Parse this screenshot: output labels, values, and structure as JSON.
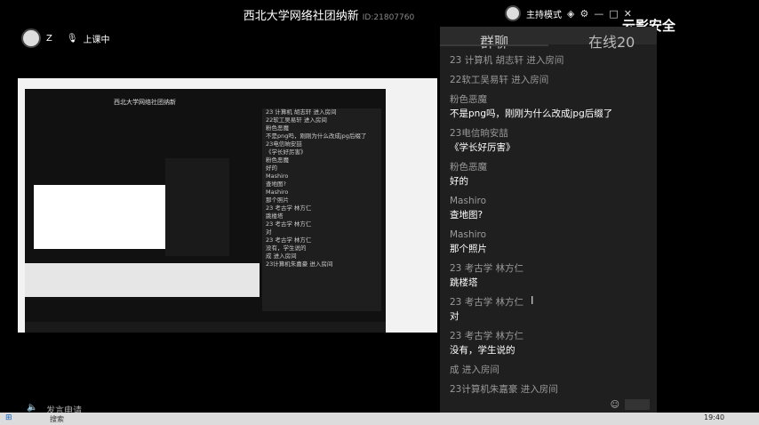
{
  "window": {
    "title": "西北大学网络社团纳新",
    "room_id": "ID:21807760",
    "host_mode": "主持模式"
  },
  "user": {
    "name": "Z",
    "status": "上课中"
  },
  "watermark": "云影安全",
  "chat": {
    "tab_chat": "群聊",
    "tab_online": "在线20",
    "messages": [
      {
        "type": "system",
        "text": "23 计算机 胡志轩 进入房间"
      },
      {
        "type": "system",
        "text": "22软工吴易轩 进入房间"
      },
      {
        "type": "message",
        "name": "粉色恶魔",
        "text": "不是png吗，刚刚为什么改成jpg后缀了"
      },
      {
        "type": "message",
        "name": "23电信晌安喆",
        "text": "《学长好厉害》"
      },
      {
        "type": "message",
        "name": "粉色恶魔",
        "text": "好的"
      },
      {
        "type": "message",
        "name": "Mashiro",
        "text": "查地图?"
      },
      {
        "type": "message",
        "name": "Mashiro",
        "text": "那个照片"
      },
      {
        "type": "message",
        "name": "23 考古学 林方仁",
        "text": "跳楼塔"
      },
      {
        "type": "message",
        "name": "23 考古学 林方仁",
        "text": "对"
      },
      {
        "type": "message",
        "name": "23 考古学 林方仁",
        "text": "没有，学生说的"
      },
      {
        "type": "system",
        "text": "成 进入房间"
      },
      {
        "type": "system",
        "text": "23计算机朱嘉豪 进入房间"
      }
    ]
  },
  "inner": {
    "title": "西北大学网络社团纳新",
    "lines": [
      "23 计算机 胡志轩 进入房间",
      "22软工吴易轩 进入房间",
      "粉色恶魔",
      "不是png吗，刚刚为什么改成jpg后缀了",
      "23电信晌安喆",
      "《学长好厉害》",
      "粉色恶魔",
      "好的",
      "Mashiro",
      "查地图?",
      "Mashiro",
      "那个照片",
      "23 考古学 林方仁",
      "跳楼塔",
      "23 考古学 林方仁",
      "对",
      "23 考古学 林方仁",
      "没有，学生说的",
      "成 进入房间",
      "23计算机朱嘉豪 进入房间"
    ]
  },
  "controls": {
    "speak_label": "发言申请"
  },
  "taskbar": {
    "search": "搜索",
    "time": "19:40"
  },
  "colors": {
    "chat_bg": "#1f1f1f",
    "name_gray": "#9a9a9a"
  }
}
